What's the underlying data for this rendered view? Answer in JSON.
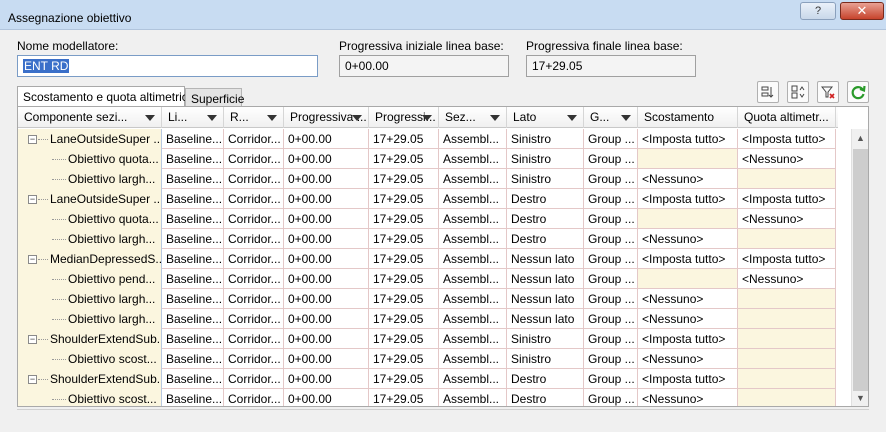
{
  "window": {
    "title": "Assegnazione obiettivo"
  },
  "fields": {
    "modeler_label": "Nome modellatore:",
    "modeler_value": "ENT RD",
    "start_label": "Progressiva iniziale linea base:",
    "start_value": "0+00.00",
    "end_label": "Progressiva finale linea base:",
    "end_value": "17+29.05"
  },
  "tabs": [
    {
      "label": "Scostamento e quota altimetrica"
    },
    {
      "label": "Superficie"
    }
  ],
  "toolbar_icons": [
    "sort-icon",
    "expand-icon",
    "clear-filter-icon",
    "refresh-icon"
  ],
  "columns": [
    "Componente sezi...",
    "Li...",
    "R...",
    "Progressiva ...",
    "Progressi...",
    "Sez...",
    "Lato",
    "G...",
    "Scostamento",
    "Quota altimetr..."
  ],
  "rows": [
    {
      "level": 0,
      "name": "LaneOutsideSuper ...",
      "cells": [
        "Baseline...",
        "Corridor...",
        "0+00.00",
        "17+29.05",
        "Assembl...",
        "Sinistro",
        "Group ...",
        "<Imposta tutto>",
        "<Imposta tutto>"
      ]
    },
    {
      "level": 1,
      "name": "Obiettivo quota...",
      "cells": [
        "Baseline...",
        "Corridor...",
        "0+00.00",
        "17+29.05",
        "Assembl...",
        "Sinistro",
        "Group ...",
        "",
        "<Nessuno>"
      ]
    },
    {
      "level": 1,
      "name": "Obiettivo largh...",
      "cells": [
        "Baseline...",
        "Corridor...",
        "0+00.00",
        "17+29.05",
        "Assembl...",
        "Sinistro",
        "Group ...",
        "<Nessuno>",
        ""
      ]
    },
    {
      "level": 0,
      "name": "LaneOutsideSuper ...",
      "cells": [
        "Baseline...",
        "Corridor...",
        "0+00.00",
        "17+29.05",
        "Assembl...",
        "Destro",
        "Group ...",
        "<Imposta tutto>",
        "<Imposta tutto>"
      ]
    },
    {
      "level": 1,
      "name": "Obiettivo quota...",
      "cells": [
        "Baseline...",
        "Corridor...",
        "0+00.00",
        "17+29.05",
        "Assembl...",
        "Destro",
        "Group ...",
        "",
        "<Nessuno>"
      ]
    },
    {
      "level": 1,
      "name": "Obiettivo largh...",
      "cells": [
        "Baseline...",
        "Corridor...",
        "0+00.00",
        "17+29.05",
        "Assembl...",
        "Destro",
        "Group ...",
        "<Nessuno>",
        ""
      ]
    },
    {
      "level": 0,
      "name": "MedianDepressedS...",
      "cells": [
        "Baseline...",
        "Corridor...",
        "0+00.00",
        "17+29.05",
        "Assembl...",
        "Nessun lato",
        "Group ...",
        "<Imposta tutto>",
        "<Imposta tutto>"
      ]
    },
    {
      "level": 1,
      "name": "Obiettivo pend...",
      "cells": [
        "Baseline...",
        "Corridor...",
        "0+00.00",
        "17+29.05",
        "Assembl...",
        "Nessun lato",
        "Group ...",
        "",
        "<Nessuno>"
      ]
    },
    {
      "level": 1,
      "name": "Obiettivo largh...",
      "cells": [
        "Baseline...",
        "Corridor...",
        "0+00.00",
        "17+29.05",
        "Assembl...",
        "Nessun lato",
        "Group ...",
        "<Nessuno>",
        ""
      ]
    },
    {
      "level": 1,
      "name": "Obiettivo largh...",
      "cells": [
        "Baseline...",
        "Corridor...",
        "0+00.00",
        "17+29.05",
        "Assembl...",
        "Nessun lato",
        "Group ...",
        "<Nessuno>",
        ""
      ]
    },
    {
      "level": 0,
      "name": "ShoulderExtendSub...",
      "cells": [
        "Baseline...",
        "Corridor...",
        "0+00.00",
        "17+29.05",
        "Assembl...",
        "Sinistro",
        "Group ...",
        "<Imposta tutto>",
        ""
      ]
    },
    {
      "level": 1,
      "name": "Obiettivo scost...",
      "cells": [
        "Baseline...",
        "Corridor...",
        "0+00.00",
        "17+29.05",
        "Assembl...",
        "Sinistro",
        "Group ...",
        "<Nessuno>",
        ""
      ]
    },
    {
      "level": 0,
      "name": "ShoulderExtendSub...",
      "cells": [
        "Baseline...",
        "Corridor...",
        "0+00.00",
        "17+29.05",
        "Assembl...",
        "Destro",
        "Group ...",
        "<Imposta tutto>",
        ""
      ]
    },
    {
      "level": 1,
      "name": "Obiettivo scost...",
      "cells": [
        "Baseline...",
        "Corridor...",
        "0+00.00",
        "17+29.05",
        "Assembl...",
        "Destro",
        "Group ...",
        "<Nessuno>",
        ""
      ]
    }
  ],
  "colors": {
    "titlebar": "#c8dcf2",
    "tree_bg": "#fbf6df",
    "grid_line": "#e4c8c8",
    "selection": "#3a6fc9"
  }
}
